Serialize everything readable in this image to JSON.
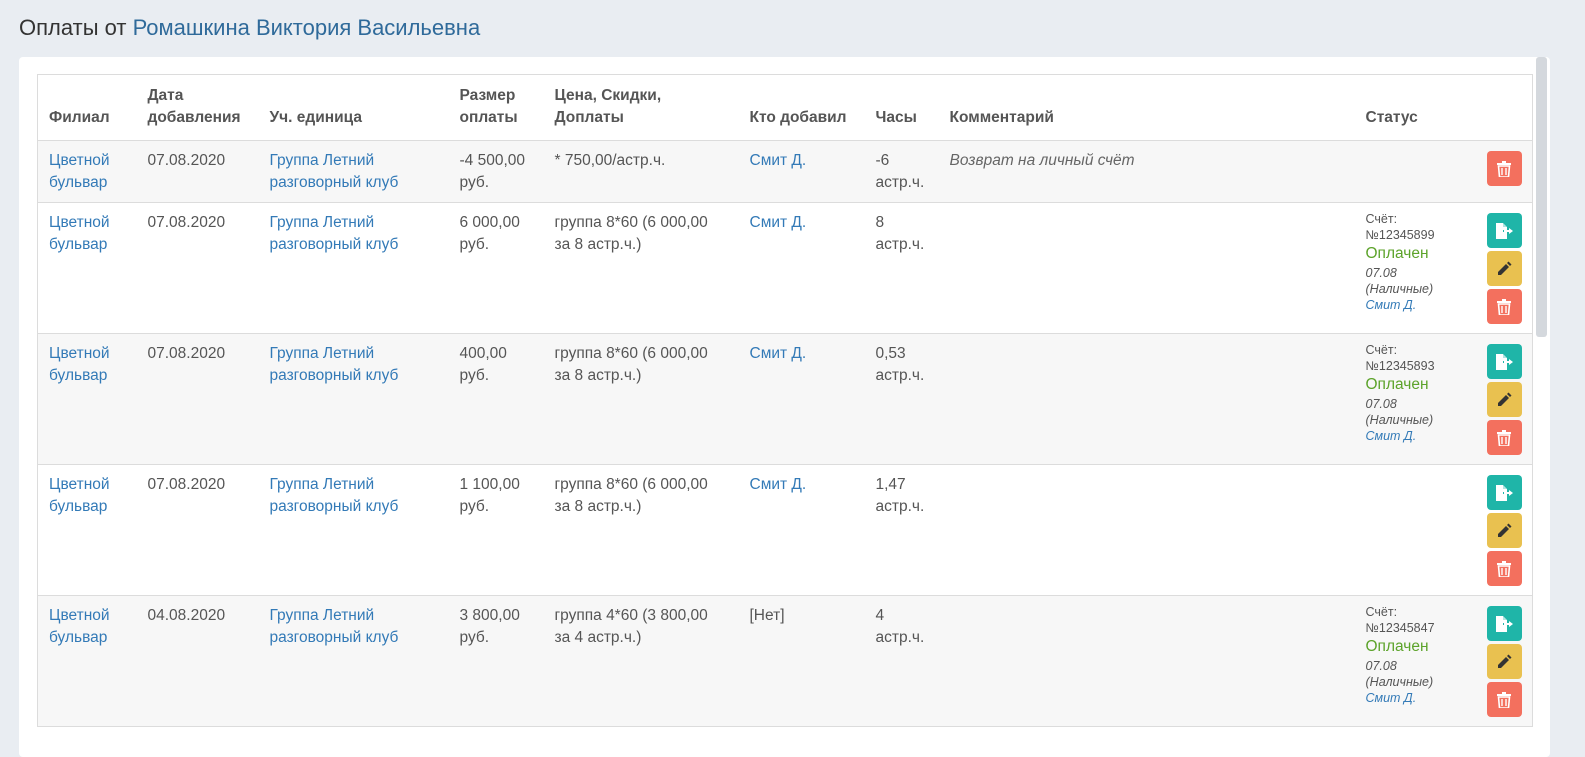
{
  "page": {
    "title_prefix": "Оплаты от",
    "client_name": "Ромашкина Виктория Васильевна"
  },
  "table": {
    "headers": {
      "branch": "Филиал",
      "date": "Дата добавления",
      "unit": "Уч. единица",
      "amount": "Размер оплаты",
      "price": "Цена, Скидки, Доплаты",
      "added_by": "Кто добавил",
      "hours": "Часы",
      "comment": "Комментарий",
      "status": "Статус"
    },
    "rows": [
      {
        "branch": "Цветной бульвар",
        "date": "07.08.2020",
        "unit": "Группа Летний разговорный клуб",
        "amount": "-4 500,00 руб.",
        "price": "* 750,00/астр.ч.",
        "added_by": "Смит Д.",
        "hours": "-6 астр.ч.",
        "comment": "Возврат на личный счёт",
        "invoice": "",
        "status": "",
        "status_date": "",
        "status_by": ""
      },
      {
        "branch": "Цветной бульвар",
        "date": "07.08.2020",
        "unit": "Группа Летний разговорный клуб",
        "amount": "6 000,00 руб.",
        "price": "группа 8*60 (6 000,00 за 8 астр.ч.)",
        "added_by": "Смит Д.",
        "hours": "8 астр.ч.",
        "comment": "",
        "invoice": "Счёт: №12345899",
        "status": "Оплачен",
        "status_date": "07.08 (Наличные)",
        "status_by": "Смит Д."
      },
      {
        "branch": "Цветной бульвар",
        "date": "07.08.2020",
        "unit": "Группа Летний разговорный клуб",
        "amount": "400,00 руб.",
        "price": "группа 8*60 (6 000,00 за 8 астр.ч.)",
        "added_by": "Смит Д.",
        "hours": "0,53 астр.ч.",
        "comment": "",
        "invoice": "Счёт: №12345893",
        "status": "Оплачен",
        "status_date": "07.08 (Наличные)",
        "status_by": "Смит Д."
      },
      {
        "branch": "Цветной бульвар",
        "date": "07.08.2020",
        "unit": "Группа Летний разговорный клуб",
        "amount": "1 100,00 руб.",
        "price": "группа 8*60 (6 000,00 за 8 астр.ч.)",
        "added_by": "Смит Д.",
        "hours": "1,47 астр.ч.",
        "comment": "",
        "invoice": "",
        "status": "",
        "status_date": "",
        "status_by": ""
      },
      {
        "branch": "Цветной бульвар",
        "date": "04.08.2020",
        "unit": "Группа Летний разговорный клуб",
        "amount": "3 800,00 руб.",
        "price": "группа 4*60 (3 800,00 за 4 астр.ч.)",
        "added_by": "[Нет]",
        "hours": "4 астр.ч.",
        "comment": "",
        "invoice": "Счёт: №12345847",
        "status": "Оплачен",
        "status_date": "07.08 (Наличные)",
        "status_by": "Смит Д."
      }
    ]
  },
  "icons": {
    "export": "file-export-icon",
    "edit": "pencil-icon",
    "delete": "trash-icon"
  },
  "colors": {
    "link": "#337ab7",
    "paid": "#5ca32a",
    "export_button": "#1fb5a8",
    "edit_button": "#e9c150",
    "delete_button": "#f3705e"
  }
}
